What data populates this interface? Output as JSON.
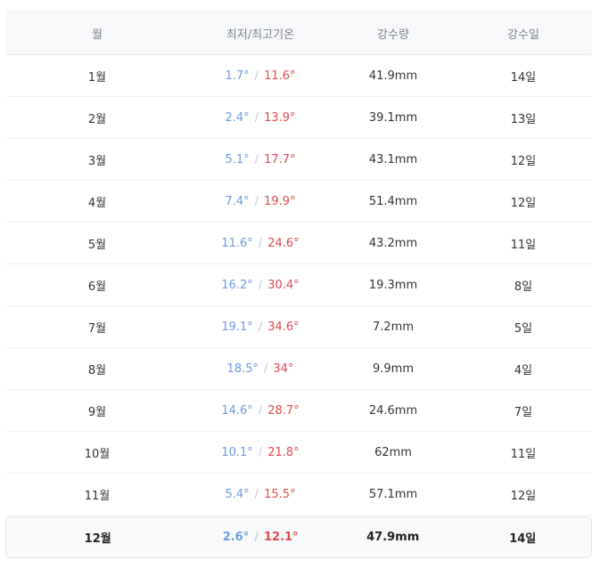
{
  "header": {
    "month": "월",
    "temp": "최저/최고기온",
    "precip": "강수량",
    "days": "강수일"
  },
  "separator": "/",
  "rows": [
    {
      "month": "1월",
      "min": "1.7°",
      "max": "11.6°",
      "precip": "41.9mm",
      "days": "14일"
    },
    {
      "month": "2월",
      "min": "2.4°",
      "max": "13.9°",
      "precip": "39.1mm",
      "days": "13일"
    },
    {
      "month": "3월",
      "min": "5.1°",
      "max": "17.7°",
      "precip": "43.1mm",
      "days": "12일"
    },
    {
      "month": "4월",
      "min": "7.4°",
      "max": "19.9°",
      "precip": "51.4mm",
      "days": "12일"
    },
    {
      "month": "5월",
      "min": "11.6°",
      "max": "24.6°",
      "precip": "43.2mm",
      "days": "11일"
    },
    {
      "month": "6월",
      "min": "16.2°",
      "max": "30.4°",
      "precip": "19.3mm",
      "days": "8일"
    },
    {
      "month": "7월",
      "min": "19.1°",
      "max": "34.6°",
      "precip": "7.2mm",
      "days": "5일"
    },
    {
      "month": "8월",
      "min": "18.5°",
      "max": "34°",
      "precip": "9.9mm",
      "days": "4일"
    },
    {
      "month": "9월",
      "min": "14.6°",
      "max": "28.7°",
      "precip": "24.6mm",
      "days": "7일"
    },
    {
      "month": "10월",
      "min": "10.1°",
      "max": "21.8°",
      "precip": "62mm",
      "days": "11일"
    },
    {
      "month": "11월",
      "min": "5.4°",
      "max": "15.5°",
      "precip": "57.1mm",
      "days": "12일"
    },
    {
      "month": "12월",
      "min": "2.6°",
      "max": "12.1°",
      "precip": "47.9mm",
      "days": "14일",
      "current": true
    }
  ],
  "colors": {
    "min": "#6e9be0",
    "max": "#e04a52",
    "header_bg": "#f7f8fa"
  }
}
